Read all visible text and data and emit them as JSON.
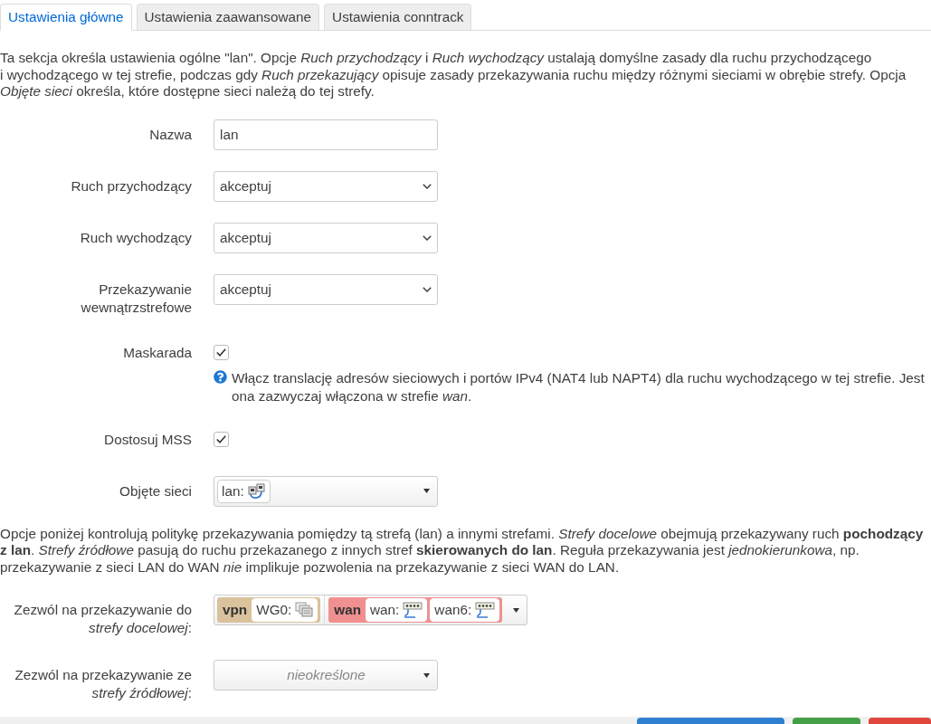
{
  "tabs": [
    {
      "label": "Ustawienia główne",
      "selected": true
    },
    {
      "label": "Ustawienia zaawansowane",
      "selected": false
    },
    {
      "label": "Ustawienia conntrack",
      "selected": false
    }
  ],
  "intro": "Ta sekcja określa ustawienia ogólne \"lan\". Opcje *Ruch przychodzący* i *Ruch wychodzący* ustalają domyślne zasady dla ruchu przychodzącego\ni wychodzącego w tej strefie, podczas gdy *Ruch przekazujący* opisuje zasady przekazywania ruchu między różnymi sieciami w obrębie strefy. Opcja *Objęte sieci* określa, które dostępne sieci należą do tej strefy.",
  "fields": [
    {
      "kind": "text",
      "label": "Nazwa",
      "value": "lan"
    },
    {
      "kind": "select",
      "label": "Ruch przychodzący",
      "value": "akceptuj"
    },
    {
      "kind": "select",
      "label": "Ruch wychodzący",
      "value": "akceptuj"
    },
    {
      "kind": "select",
      "label": "Przekazywanie wewnątrzstrefowe",
      "value": "akceptuj"
    },
    {
      "kind": "checkbox",
      "label": "Maskarada",
      "checked": true,
      "help": "Włącz translację adresów sieciowych i portów IPv4 (NAT4 lub NAPT4) dla ruchu wychodzącego w tej strefie. Jest ona zazwyczaj włączona w strefie *wan*."
    },
    {
      "kind": "checkbox",
      "label": "Dostosuj MSS",
      "checked": true
    },
    {
      "kind": "networks",
      "label": "Objęte sieci",
      "networks": [
        {
          "name": "lan:",
          "kind": "bridge"
        }
      ]
    }
  ],
  "forwarding_intro": "Opcje poniżej kontrolują politykę przekazywania pomiędzy tą strefą (lan) a innymi strefami. *Strefy docelowe* obejmują przekazywany ruch **pochodzący z lan**. *Strefy źródłowe* pasują do ruchu przekazanego z innych stref **skierowanych do lan**. Reguła przekazywania jest *jednokierunkowa*, np.\nprzekazywanie z sieci LAN do WAN *nie* implikuje pozwolenia na przekazywanie z sieci WAN do LAN.",
  "forwarding_fields": [
    {
      "label": "Zezwól na przekazywanie do *strefy docelowej*:",
      "zones": [
        {
          "name": "vpn",
          "color": "#d9c29c",
          "networks": [
            {
              "name": "WG0:",
              "kind": "tunnel"
            }
          ]
        },
        {
          "name": "wan",
          "color": "#f09090",
          "networks": [
            {
              "name": "wan:",
              "kind": "ethernet"
            },
            {
              "name": "wan6:",
              "kind": "ethernet"
            }
          ]
        }
      ]
    },
    {
      "label": "Zezwól na przekazywanie ze *strefy źródłowej*:",
      "placeholder": "nieokreślone"
    }
  ],
  "footer_buttons": [
    {
      "color": "#2f80d1"
    },
    {
      "color": "#44a047"
    },
    {
      "color": "#e0463c"
    }
  ]
}
